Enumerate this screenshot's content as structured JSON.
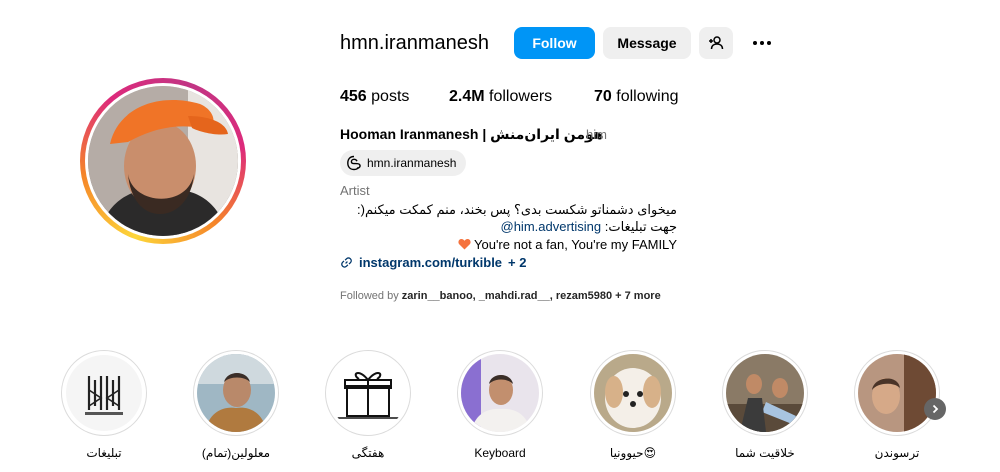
{
  "profile": {
    "username": "hmn.iranmanesh",
    "follow_label": "Follow",
    "message_label": "Message",
    "stats": {
      "posts_count": "456",
      "posts_label": "posts",
      "followers_count": "2.4M",
      "followers_label": "followers",
      "following_count": "70",
      "following_label": "following"
    },
    "full_name": "Hooman Iranmanesh | هومن ایران‌منش",
    "pronoun": "him",
    "threads_handle": "hmn.iranmanesh",
    "category": "Artist",
    "bio_line1": "میخوای دشمناتو شکست بدی؟ پس بخند، منم کمکت میکنم(:",
    "bio_line2_prefix": "جهت تبلیغات: ",
    "bio_line2_handle": "@him.advertising",
    "bio_line3": "You're not a fan, You're my FAMILY",
    "link_text": "instagram.com/turkible",
    "link_extra": "+ 2",
    "followed_by_prefix": "Followed by",
    "followed_by_names": "zarin__banoo, _mahdi.rad__, rezam5980",
    "followed_by_more": "+ 7 more"
  },
  "highlights": [
    {
      "label": "تبلیغات"
    },
    {
      "label": "معلولین(تمام)"
    },
    {
      "label": "هفتگی"
    },
    {
      "label": "Keyboard"
    },
    {
      "label": "حیوونیا😍"
    },
    {
      "label": "خلاقیت شما"
    },
    {
      "label": "ترسوندن"
    }
  ],
  "colors": {
    "primary_blue": "#0095f6",
    "secondary_button": "#efefef",
    "muted_text": "#737373",
    "link_text": "#00376b"
  },
  "icons": [
    "add-user-icon",
    "more-icon",
    "threads-icon",
    "link-icon",
    "heart-icon",
    "chevron-right-icon"
  ]
}
